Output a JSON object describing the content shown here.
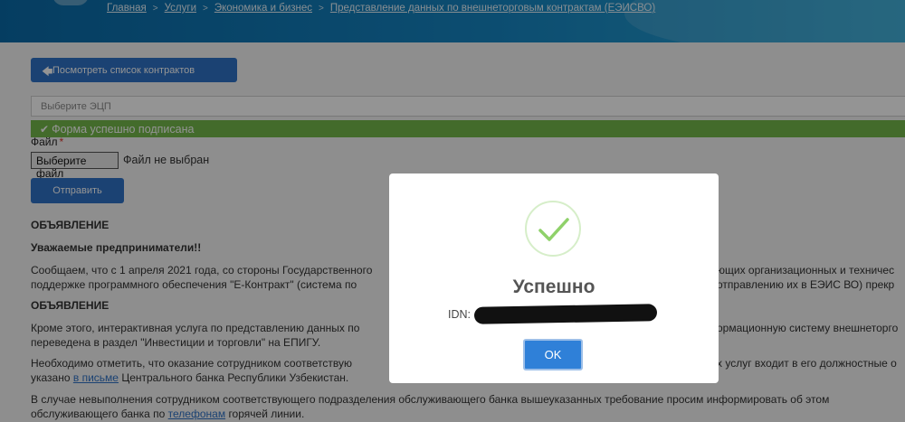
{
  "breadcrumb": [
    {
      "label": "Главная"
    },
    {
      "label": "Услуги"
    },
    {
      "label": "Экономика и бизнес"
    },
    {
      "label": "Представление данных по внешнеторговым контрактам (ЕЭИСВО)"
    }
  ],
  "actions": {
    "view_contracts_label": "Посмотреть список контрактов",
    "submit_label": "Отправить"
  },
  "ecp_select": {
    "placeholder": "Выберите ЭЦП"
  },
  "alert": {
    "text": "Форма успешно подписана",
    "color": "#74b94a"
  },
  "file": {
    "label": "Файл",
    "required_mark": "*",
    "button_label": "Выберите файл",
    "status": "Файл не выбран"
  },
  "announcements": {
    "heading1": "ОБЪЯВЛЕНИЕ",
    "greeting": "Уважаемые предприниматели!!",
    "p1_line1_a": "Сообщаем, что с 1 апреля 2021 года, со стороны Государственного",
    "p1_line1_b": "ющих организационных и техничес",
    "p1_line2_a": "поддержке программного обеспечения \"Е-Контракт\" (система по",
    "p1_line2_b": "отправлению их в ЕЭИС ВО) прекр",
    "heading2": "ОБЪЯВЛЕНИЕ",
    "p2_line1_a": "Кроме этого, интерактивная услуга по представлению данных по",
    "p2_line1_b": "ормационную систему внешнеторго",
    "p2_line2": "переведена в раздел \"Инвестиции и торговли\" на ЕПИГУ.",
    "p3_line1_a": "Необходимо отметить, что оказание сотрудником соответствую",
    "p3_line1_b": "х услуг входит в его должностные о",
    "p3_line2_before": "указано",
    "p3_line2_link": "в письме",
    "p3_line2_after": "Центрального банка Республики Узбекистан.",
    "p4_line1": "В случае невыполнения сотрудником соответствующего подразделения обслуживающего банка вышеуказанных требование просим информировать об этом",
    "p4_line2_before": "обслуживающего банка по",
    "p4_line2_link": "телефонам",
    "p4_line2_after": "горячей линии."
  },
  "modal": {
    "title": "Успешно",
    "idn_label": "IDN:",
    "ok_label": "OK",
    "accent": "#2f80d8"
  },
  "colors": {
    "primary_button": "#2f72c6",
    "header": "#1686c3"
  }
}
